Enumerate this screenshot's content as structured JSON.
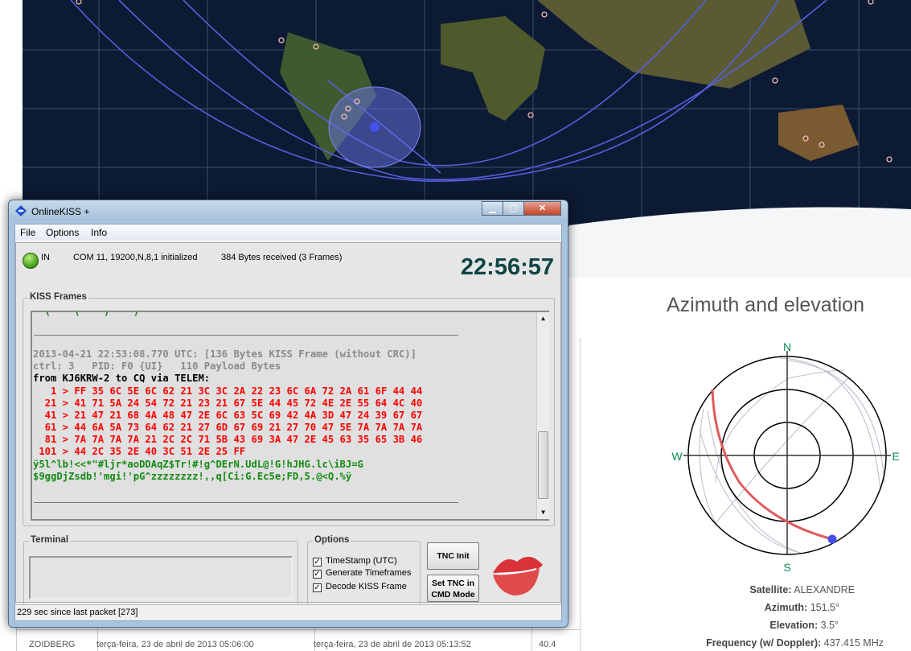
{
  "map": {
    "colors": {
      "ocean": "#0d1a33",
      "grid": "#3a4d70",
      "orbit": "#5560e0",
      "footprint": "#6470d8"
    }
  },
  "background_table": {
    "row": {
      "name": "ZOIDBERG",
      "start": "terça-feira, 23 de abril de 2013 05:06:00",
      "end": "terça-feira, 23 de abril de 2013 05:13:52",
      "value": "40.4"
    }
  },
  "azel": {
    "title": "Azimuth and elevation",
    "compass": {
      "n": "N",
      "s": "S",
      "e": "E",
      "w": "W"
    },
    "satellite_label": "Satellite:",
    "satellite": "ALEXANDRE",
    "azimuth_label": "Azimuth:",
    "azimuth": "151.5°",
    "elevation_label": "Elevation:",
    "elevation": "3.5°",
    "frequency_label": "Frequency (w/ Doppler):",
    "frequency": "437.415 MHz"
  },
  "window": {
    "title": "OnlineKISS +",
    "menu": [
      "File",
      "Options",
      "Info"
    ],
    "status": {
      "led_label": "IN",
      "port": "COM 11, 19200,N,8,1 initialized",
      "bytes": "384 Bytes received (3 Frames)",
      "clock": "22:56:57"
    },
    "frames_title": "KISS Frames",
    "frame": {
      "header": "2013-04-21 22:53:08.770 UTC: [136 Bytes KISS Frame (without CRC)]",
      "ctrl": "ctrl: 3   PID: F0 {UI}   110 Payload Bytes",
      "route": "from KJ6KRW-2 to CQ via TELEM:",
      "hex": [
        "   1 > FF 35 6C 5E 6C 62 21 3C 3C 2A 22 23 6C 6A 72 2A 61 6F 44 44",
        "  21 > 41 71 5A 24 54 72 21 23 21 67 5E 44 45 72 4E 2E 55 64 4C 40",
        "  41 > 21 47 21 68 4A 48 47 2E 6C 63 5C 69 42 4A 3D 47 24 39 67 67",
        "  61 > 44 6A 5A 73 64 62 21 27 6D 67 69 21 27 70 47 5E 7A 7A 7A 7A",
        "  81 > 7A 7A 7A 7A 21 2C 2C 71 5B 43 69 3A 47 2E 45 63 35 65 3B 46",
        " 101 > 44 2C 35 2E 40 3C 51 2E 25 FF"
      ],
      "ascii": [
        "ÿ5l^lb!<<*\"#ljr*aoDDAqZ$Tr!#!g^DErN.UdL@!G!hJHG.lc\\iBJ=G",
        "$9ggDjZsdb!'mgi!'pG^zzzzzzzz!,,q[Ci:G.Ec5e;FD,5.@<Q.%ÿ"
      ]
    },
    "terminal_title": "Terminal",
    "terminal_value": "",
    "options_title": "Options",
    "options": [
      {
        "label": "TimeStamp (UTC)",
        "checked": true
      },
      {
        "label": "Generate Timeframes",
        "checked": true
      },
      {
        "label": "Decode KISS Frame",
        "checked": true
      }
    ],
    "tnc_init": "TNC Init",
    "set_tnc_1": "Set TNC in",
    "set_tnc_2": "CMD Mode",
    "statusbar": "229 sec since last packet [273]"
  }
}
